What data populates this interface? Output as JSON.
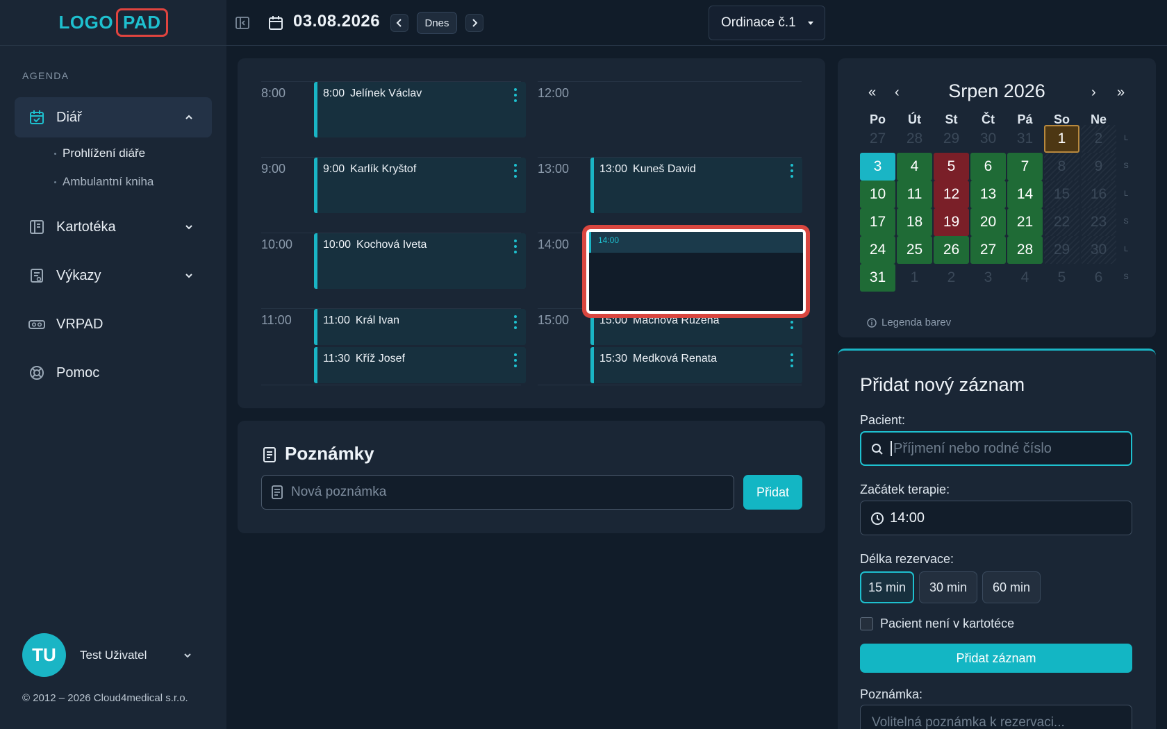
{
  "logo": {
    "part1": "LOGO",
    "part2": "PAD"
  },
  "sidebar": {
    "section_label": "AGENDA",
    "items": [
      {
        "label": "Diář"
      },
      {
        "label": "Kartotéka"
      },
      {
        "label": "Výkazy"
      },
      {
        "label": "VRPAD"
      },
      {
        "label": "Pomoc"
      }
    ],
    "subitems": [
      {
        "label": "Prohlížení diáře"
      },
      {
        "label": "Ambulantní kniha"
      }
    ],
    "user": {
      "initials": "TU",
      "name": "Test Uživatel"
    },
    "copyright": "© 2012 – 2026 Cloud4medical s.r.o."
  },
  "topbar": {
    "date": "03.08.2026",
    "today_label": "Dnes",
    "room": "Ordinace č.1"
  },
  "schedule": {
    "left_times": [
      "8:00",
      "9:00",
      "10:00",
      "11:00"
    ],
    "right_times": [
      "12:00",
      "13:00",
      "14:00",
      "15:00"
    ],
    "appointments": [
      {
        "time": "8:00",
        "name": "Jelínek Václav"
      },
      {
        "time": "9:00",
        "name": "Karlík Kryštof"
      },
      {
        "time": "10:00",
        "name": "Kochová Iveta"
      },
      {
        "time": "11:00",
        "name": "Král Ivan"
      },
      {
        "time": "11:30",
        "name": "Kříž Josef"
      },
      {
        "time": "13:00",
        "name": "Kuneš David"
      },
      {
        "time": "15:00",
        "name": "Machová Růžena"
      },
      {
        "time": "15:30",
        "name": "Medková Renata"
      }
    ],
    "new_slot_time": "14:00"
  },
  "notes": {
    "title": "Poznámky",
    "placeholder": "Nová poznámka",
    "add_label": "Přidat"
  },
  "calendar": {
    "month": "Srpen 2026",
    "nav": {
      "prev_year": "«",
      "prev": "‹",
      "next": "›",
      "next_year": "»"
    },
    "weekdays": [
      "Po",
      "Út",
      "St",
      "Čt",
      "Pá",
      "So",
      "Ne"
    ],
    "weeks": [
      [
        {
          "d": "27",
          "s": "muted"
        },
        {
          "d": "28",
          "s": "muted"
        },
        {
          "d": "29",
          "s": "muted"
        },
        {
          "d": "30",
          "s": "muted"
        },
        {
          "d": "31",
          "s": "muted"
        },
        {
          "d": "1",
          "s": "sel"
        },
        {
          "d": "2",
          "s": "hatch"
        }
      ],
      [
        {
          "d": "3",
          "s": "today"
        },
        {
          "d": "4",
          "s": "green"
        },
        {
          "d": "5",
          "s": "red"
        },
        {
          "d": "6",
          "s": "green"
        },
        {
          "d": "7",
          "s": "green"
        },
        {
          "d": "8",
          "s": "hatch"
        },
        {
          "d": "9",
          "s": "hatch"
        }
      ],
      [
        {
          "d": "10",
          "s": "green"
        },
        {
          "d": "11",
          "s": "green"
        },
        {
          "d": "12",
          "s": "red"
        },
        {
          "d": "13",
          "s": "green"
        },
        {
          "d": "14",
          "s": "green"
        },
        {
          "d": "15",
          "s": "hatch"
        },
        {
          "d": "16",
          "s": "hatch"
        }
      ],
      [
        {
          "d": "17",
          "s": "green"
        },
        {
          "d": "18",
          "s": "green"
        },
        {
          "d": "19",
          "s": "red"
        },
        {
          "d": "20",
          "s": "green"
        },
        {
          "d": "21",
          "s": "green"
        },
        {
          "d": "22",
          "s": "hatch"
        },
        {
          "d": "23",
          "s": "hatch"
        }
      ],
      [
        {
          "d": "24",
          "s": "green"
        },
        {
          "d": "25",
          "s": "green"
        },
        {
          "d": "26",
          "s": "green"
        },
        {
          "d": "27",
          "s": "green"
        },
        {
          "d": "28",
          "s": "green"
        },
        {
          "d": "29",
          "s": "hatch"
        },
        {
          "d": "30",
          "s": "hatch"
        }
      ],
      [
        {
          "d": "31",
          "s": "green"
        },
        {
          "d": "1",
          "s": "muted"
        },
        {
          "d": "2",
          "s": "muted"
        },
        {
          "d": "3",
          "s": "muted"
        },
        {
          "d": "4",
          "s": "muted"
        },
        {
          "d": "5",
          "s": "muted"
        },
        {
          "d": "6",
          "s": "muted"
        }
      ]
    ],
    "week_markers": [
      "L",
      "S",
      "L",
      "S",
      "L",
      "S"
    ],
    "legend": "Legenda barev"
  },
  "add_record": {
    "title": "Přidat nový záznam",
    "patient_label": "Pacient:",
    "patient_placeholder": "Příjmení nebo rodné číslo",
    "start_label": "Začátek terapie:",
    "start_value": "14:00",
    "duration_label": "Délka rezervace:",
    "durations": [
      "15 min",
      "30 min",
      "60 min"
    ],
    "selected_duration": "15 min",
    "checkbox_label": "Pacient není v kartotéce",
    "submit_label": "Přidat záznam",
    "note_label": "Poznámka:",
    "note_placeholder": "Volitelná poznámka k rezervaci..."
  },
  "colors": {
    "accent": "#1ab5c5",
    "busy": "#1f6b36",
    "full": "#7a1f28",
    "selected": "#4d3713",
    "highlight": "#d9463f"
  }
}
